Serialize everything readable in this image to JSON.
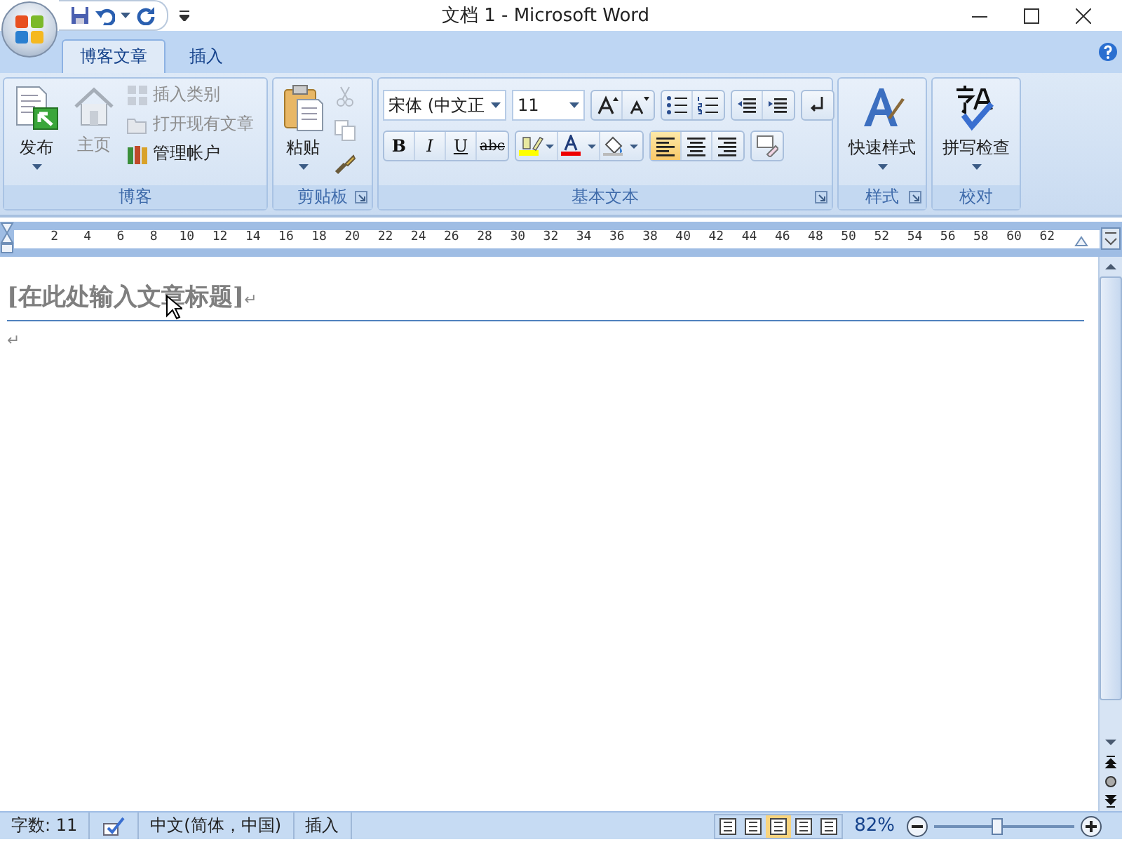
{
  "window": {
    "title": "文档 1 - Microsoft Word"
  },
  "tabs": [
    {
      "label": "博客文章",
      "selected": true
    },
    {
      "label": "插入",
      "selected": false
    }
  ],
  "ribbon": [
    {
      "kind": "blog",
      "label": "博客",
      "launcher": false,
      "buttons": [
        {
          "label": "发布",
          "disabled": false
        },
        {
          "label": "主页",
          "disabled": true
        },
        {
          "label": "插入类别",
          "disabled": true
        },
        {
          "label": "打开现有文章",
          "disabled": true
        },
        {
          "label": "管理帐户",
          "disabled": false
        }
      ]
    },
    {
      "kind": "clipboard",
      "label": "剪贴板",
      "launcher": true,
      "paste": "粘贴",
      "tools": [
        {
          "disabled": true
        },
        {
          "disabled": true
        },
        {
          "disabled": false
        }
      ]
    },
    {
      "kind": "basic_text",
      "label": "基本文本",
      "launcher": true,
      "font": "宋体 (中文正",
      "size": "11",
      "styles": [
        "B",
        "I",
        "U",
        "abc"
      ],
      "alignments": [
        {
          "selected": true
        },
        {
          "selected": false
        },
        {
          "selected": false
        }
      ]
    },
    {
      "kind": "styles",
      "label": "样式",
      "launcher": true,
      "button": "快速样式"
    },
    {
      "kind": "proofing",
      "label": "校对",
      "launcher": false,
      "button": "拼写检查"
    }
  ],
  "ruler": {
    "ticks": [
      "2",
      "4",
      "6",
      "8",
      "10",
      "12",
      "14",
      "16",
      "18",
      "20",
      "22",
      "24",
      "26",
      "28",
      "30",
      "32",
      "34",
      "36",
      "38",
      "40",
      "42",
      "44",
      "46",
      "48",
      "50",
      "52",
      "54",
      "56",
      "58",
      "60",
      "62"
    ]
  },
  "document": {
    "paragraphs": [
      {
        "kind": "title",
        "text": "[在此处输入文章标题]",
        "mark": "↵"
      },
      {
        "kind": "body",
        "mark": "↵"
      }
    ]
  },
  "status_bar": {
    "word_count": "字数: 11",
    "language": "中文(简体，中国)",
    "mode": "插入",
    "views": [
      {
        "selected": false
      },
      {
        "selected": false
      },
      {
        "selected": true
      },
      {
        "selected": false
      },
      {
        "selected": false
      }
    ],
    "zoom": "82%",
    "zoom_slider": {
      "level": 0.45
    }
  }
}
